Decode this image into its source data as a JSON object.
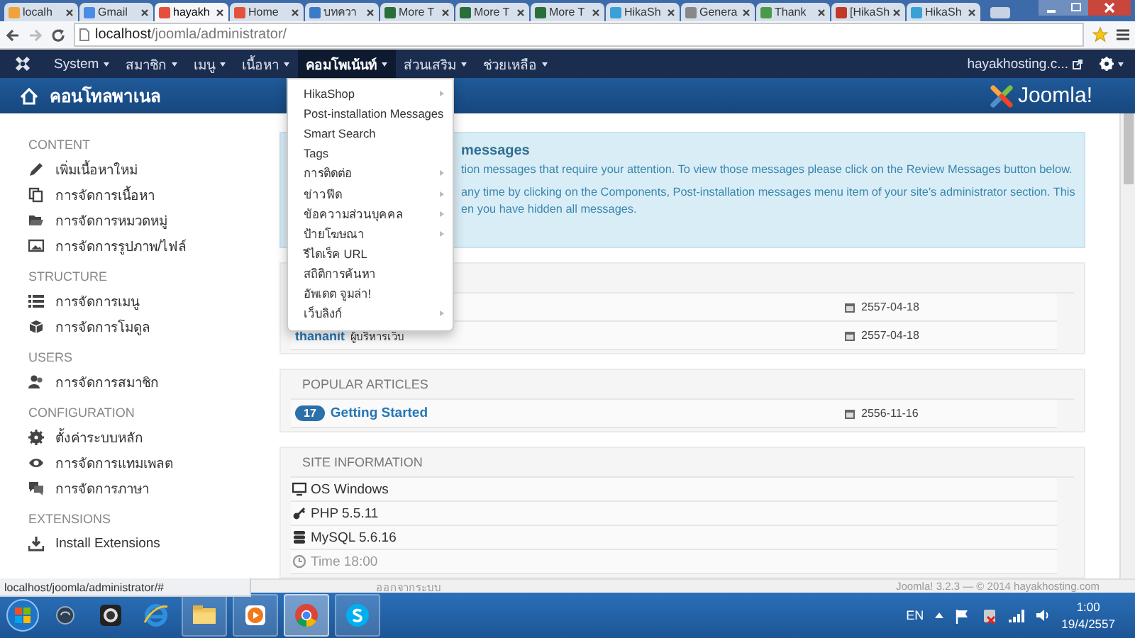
{
  "browser": {
    "tabs": [
      {
        "label": "localh",
        "selected": false
      },
      {
        "label": "Gmail",
        "selected": false
      },
      {
        "label": "hayakh",
        "selected": true
      },
      {
        "label": "Home",
        "selected": false
      },
      {
        "label": "บทควา",
        "selected": false
      },
      {
        "label": "More T",
        "selected": false
      },
      {
        "label": "More T",
        "selected": false
      },
      {
        "label": "More T",
        "selected": false
      },
      {
        "label": "HikaSh",
        "selected": false
      },
      {
        "label": "Genera",
        "selected": false
      },
      {
        "label": "Thank",
        "selected": false
      },
      {
        "label": "[HikaSh",
        "selected": false
      },
      {
        "label": "HikaSh",
        "selected": false
      }
    ],
    "address_host": "localhost",
    "address_path": "/joomla/administrator/"
  },
  "navbar": {
    "menus": [
      {
        "label": "System",
        "selected": false
      },
      {
        "label": "สมาชิก",
        "selected": false
      },
      {
        "label": "เมนู",
        "selected": false
      },
      {
        "label": "เนื้อหา",
        "selected": false
      },
      {
        "label": "คอมโพเน้นท์",
        "selected": true
      },
      {
        "label": "ส่วนเสริม",
        "selected": false
      },
      {
        "label": "ช่วยเหลือ",
        "selected": false
      }
    ],
    "user": "hayakhosting.c..."
  },
  "header": {
    "title": "คอนโทลพาเนล",
    "logo": "Joomla!"
  },
  "components_menu": [
    {
      "label": "HikaShop",
      "submenu": true
    },
    {
      "label": "Post-installation Messages",
      "submenu": false
    },
    {
      "label": "Smart Search",
      "submenu": false
    },
    {
      "label": "Tags",
      "submenu": false
    },
    {
      "label": "การติดต่อ",
      "submenu": true
    },
    {
      "label": "ข่าวฟีด",
      "submenu": true
    },
    {
      "label": "ข้อความส่วนบุคคล",
      "submenu": true
    },
    {
      "label": "ป้ายโฆษณา",
      "submenu": true
    },
    {
      "label": "รีไดเร็ค URL",
      "submenu": false
    },
    {
      "label": "สถิติการค้นหา",
      "submenu": false
    },
    {
      "label": "อัพเดต จูมล่า!",
      "submenu": false
    },
    {
      "label": "เว็บลิงก์",
      "submenu": true
    }
  ],
  "sidebar": {
    "sections": [
      {
        "heading": "CONTENT",
        "items": [
          "เพิ่มเนื้อหาใหม่",
          "การจัดการเนื้อหา",
          "การจัดการหมวดหมู่",
          "การจัดการรูปภาพ/ไฟล์"
        ]
      },
      {
        "heading": "STRUCTURE",
        "items": [
          "การจัดการเมนู",
          "การจัดการโมดูล"
        ]
      },
      {
        "heading": "USERS",
        "items": [
          "การจัดการสมาชิก"
        ]
      },
      {
        "heading": "CONFIGURATION",
        "items": [
          "ตั้งค่าระบบหลัก",
          "การจัดการแทมเพลต",
          "การจัดการภาษา"
        ]
      },
      {
        "heading": "EXTENSIONS",
        "items": [
          "Install Extensions"
        ]
      }
    ]
  },
  "message": {
    "title": "messages",
    "lines": [
      "tion messages that require your attention. To view those messages please click on the Review Messages button below.",
      "any time by clicking on the Components, Post-installation messages menu item of your site's administrator section. This",
      "en you have hidden all messages."
    ]
  },
  "recent_panel": {
    "rows": [
      {
        "date": "2557-04-18"
      },
      {
        "author": "thananit",
        "role": "ผู้บริหารเว็บ",
        "date": "2557-04-18"
      }
    ]
  },
  "popular": {
    "title": "POPULAR ARTICLES",
    "rows": [
      {
        "hits": "17",
        "title": "Getting Started",
        "date": "2556-11-16"
      }
    ]
  },
  "site_info": {
    "title": "SITE INFORMATION",
    "rows": [
      "OS Windows",
      "PHP 5.5.11",
      "MySQL 5.6.16",
      "Time 18:00"
    ]
  },
  "status_url": "localhost/joomla/administrator/#",
  "footer": {
    "logout": "ออกจากระบบ",
    "copyright": "Joomla! 3.2.3 — © 2014 hayakhosting.com"
  },
  "taskbar": {
    "apps": [
      {
        "selected": false
      },
      {
        "selected": false
      },
      {
        "selected": false
      },
      {
        "selected": true
      },
      {
        "selected": false
      }
    ],
    "language": "EN",
    "time": "1:00",
    "date": "19/4/2557"
  }
}
